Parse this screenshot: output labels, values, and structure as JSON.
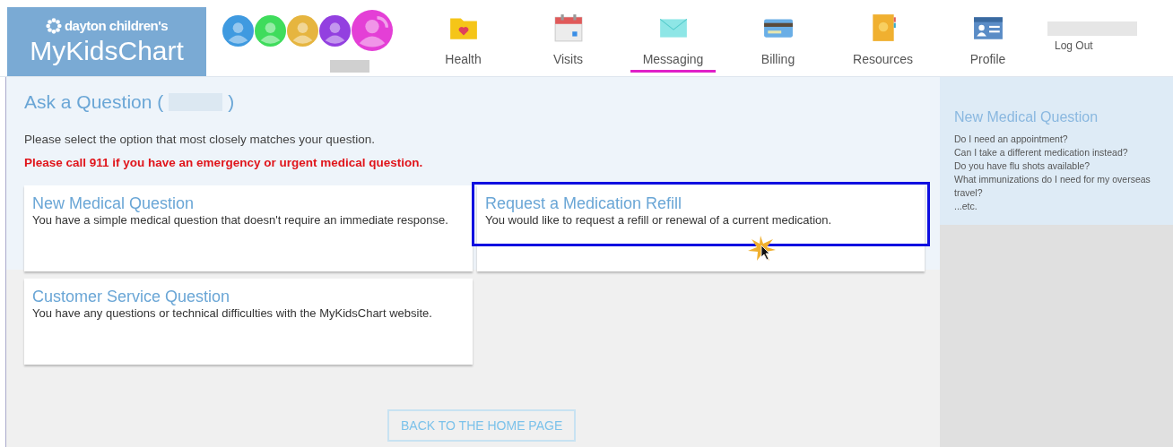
{
  "logo": {
    "brand": "dayton children's",
    "title": "MyKidsChart"
  },
  "avatars": [
    {
      "color": "#3f9ae0",
      "selected": false
    },
    {
      "color": "#3fdc5c",
      "selected": false
    },
    {
      "color": "#e6b53f",
      "selected": false
    },
    {
      "color": "#9340e0",
      "selected": false
    },
    {
      "color": "#e43fd6",
      "selected": true
    }
  ],
  "nav": [
    {
      "label": "Health",
      "selected": false
    },
    {
      "label": "Visits",
      "selected": false
    },
    {
      "label": "Messaging",
      "selected": true
    },
    {
      "label": "Billing",
      "selected": false
    },
    {
      "label": "Resources",
      "selected": false
    },
    {
      "label": "Profile",
      "selected": false
    }
  ],
  "logout": "Log Out",
  "page": {
    "title_prefix": "Ask a Question (",
    "title_suffix": ")",
    "instruction": "Please select the option that most closely matches your question.",
    "warning": "Please call 911 if you have an emergency or urgent medical question."
  },
  "options": [
    {
      "title": "New Medical Question",
      "description": "You have a simple medical question that doesn't require an immediate response.",
      "highlighted": false
    },
    {
      "title": "Request a Medication Refill",
      "description": "You would like to request a refill or renewal of a current medication.",
      "highlighted": true
    },
    {
      "title": "Customer Service Question",
      "description": "You have any questions or technical difficulties with the MyKidsChart website.",
      "highlighted": false
    }
  ],
  "back_button": "BACK TO THE HOME PAGE",
  "sidebar": {
    "title": "New Medical Question",
    "lines": [
      "Do I need an appointment?",
      "Can I take a different medication instead?",
      "Do you have flu shots available?",
      "What immunizations do I need for my overseas travel?",
      "...etc."
    ]
  }
}
